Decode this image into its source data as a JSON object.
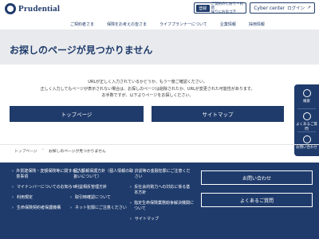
{
  "header": {
    "brand": "Prudential",
    "reg_button_icon": "登録",
    "reg_button_text": "ご契約のしおり・約款",
    "reg_button_text2": "誤りにお気づき",
    "cyber_label": "Cyber center",
    "login_label": "ログイン",
    "nav": [
      "ご契約者さま",
      "保険をお考えの皆さま",
      "ライフプランナーについて",
      "企業情報",
      "採用情報"
    ]
  },
  "hero": {
    "title": "お探しのページが見つかりません"
  },
  "message": {
    "line1": "URLが正しく入力されているかどうか、もう一度ご確認ください。",
    "line2": "正しく入力してもページが表示されない場合は、お探しのページは削除されたか、URLが変更された可能性があります。",
    "line3": "お手数ですが、以下よりページをお探しください。"
  },
  "buttons": {
    "top": "トップページ",
    "sitemap": "サイトマップ"
  },
  "side": {
    "search": "検索",
    "faq": "よくあるご質問",
    "contact": "お問い合わせ"
  },
  "breadcrumb": {
    "home": "トップページ",
    "sep": "›",
    "current": "お探しのページが見つかりません"
  },
  "footer": {
    "col1": [
      "外貨建保険・変額保険等に関するご注意事項",
      "マイナンバーについてのお知らせ",
      "利用規定",
      "生命保険契約者保護機構"
    ],
    "col2": [
      "個人情報保護方針（個人情報の取扱いについて）",
      "利益相反管理方針",
      "取引時確認について",
      "ネット犯罪にご注意ください"
    ],
    "col3": [
      "許認等の金融犯罪にご注意ください",
      "反社会的勢力への対応に係る基本方針",
      "指定生命保険業務紛争解決機関について",
      "サイトマップ"
    ],
    "contact_button": "お問い合わせ",
    "faq_button": "よくあるご質問",
    "arrow": "›"
  }
}
